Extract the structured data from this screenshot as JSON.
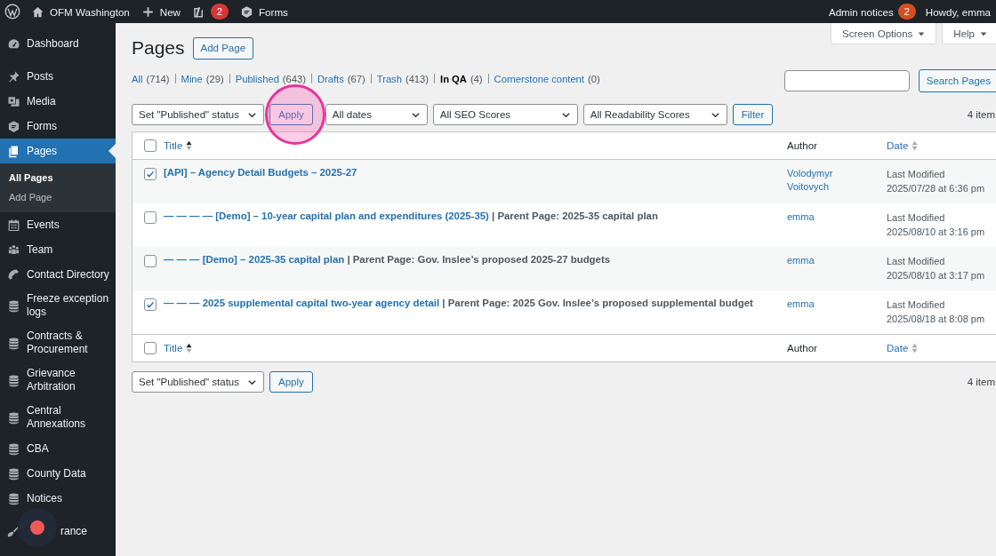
{
  "admin_bar": {
    "site_name": "OFM Washington",
    "new_label": "New",
    "seo_badge": "2",
    "forms_label": "Forms",
    "notices_label": "Admin notices",
    "notices_badge": "2",
    "greeting": "Howdy, emma"
  },
  "sidebar": {
    "groups": [
      {
        "items": [
          {
            "label": "Dashboard",
            "selected": false
          }
        ]
      },
      {
        "items": [
          {
            "label": "Posts",
            "selected": false
          },
          {
            "label": "Media",
            "selected": false
          },
          {
            "label": "Forms",
            "selected": false
          },
          {
            "label": "Pages",
            "selected": true,
            "children": [
              {
                "label": "All Pages",
                "selected": true
              },
              {
                "label": "Add Page",
                "selected": false
              }
            ]
          },
          {
            "label": "Events",
            "selected": false
          },
          {
            "label": "Team",
            "selected": false
          },
          {
            "label": "Contact Directory",
            "selected": false
          },
          {
            "label": "Freeze exception logs",
            "selected": false
          },
          {
            "label": "Contracts & Procurement",
            "selected": false
          },
          {
            "label": "Grievance Arbitration",
            "selected": false
          },
          {
            "label": "Central Annexations",
            "selected": false
          },
          {
            "label": "CBA",
            "selected": false
          },
          {
            "label": "County Data",
            "selected": false
          },
          {
            "label": "Notices",
            "selected": false
          }
        ]
      },
      {
        "items": [
          {
            "label": "rance",
            "selected": false,
            "covered": true
          }
        ]
      }
    ]
  },
  "screen_meta": [
    {
      "label": "Screen Options"
    },
    {
      "label": "Help"
    }
  ],
  "heading": {
    "title": "Pages",
    "button": "Add Page"
  },
  "views": [
    {
      "label": "All",
      "count": "(714)",
      "selected": false
    },
    {
      "label": "Mine",
      "count": "(29)",
      "selected": false
    },
    {
      "label": "Published",
      "count": "(643)",
      "selected": false
    },
    {
      "label": "Drafts",
      "count": "(67)",
      "selected": false
    },
    {
      "label": "Trash",
      "count": "(413)",
      "selected": false
    },
    {
      "label": "In QA",
      "count": "(4)",
      "selected": true
    },
    {
      "label": "Cornerstone content",
      "count": "(0)",
      "selected": false
    }
  ],
  "search": {
    "button": "Search Pages"
  },
  "bulk_top": {
    "action": "Set \"Published\" status",
    "apply": "Apply"
  },
  "filters": [
    {
      "value": "All dates"
    },
    {
      "value": "All SEO Scores"
    },
    {
      "value": "All Readability Scores"
    }
  ],
  "filter_button": "Filter",
  "items_count_top": "4 item",
  "table": {
    "header": {
      "checked": false,
      "columns": [
        {
          "label": "Title",
          "kind": "sortable",
          "sorted": true
        },
        {
          "label": "Author",
          "kind": "plain"
        },
        {
          "label": "Date",
          "kind": "sortable",
          "sorted": false
        }
      ]
    },
    "rows": [
      {
        "checked": true,
        "title": "[API] – Agency Detail Budgets – 2025-27",
        "author": [
          "Volodymyr",
          "Voitovych"
        ],
        "date_status": "Last Modified",
        "date": "2025/07/28 at 6:36 pm"
      },
      {
        "checked": false,
        "title": "— — — — [Demo] – 10-year capital plan and expenditures (2025-35)",
        "parent": "| Parent Page: 2025-35 capital plan",
        "author": [
          "emma"
        ],
        "date_status": "Last Modified",
        "date": "2025/08/10 at 3:16 pm"
      },
      {
        "checked": false,
        "title": "— — — [Demo] – 2025-35 capital plan",
        "parent": "| Parent Page: Gov. Inslee’s proposed 2025-27 budgets",
        "author": [
          "emma"
        ],
        "date_status": "Last Modified",
        "date": "2025/08/10 at 3:17 pm"
      },
      {
        "checked": true,
        "title": "— — — 2025 supplemental capital two-year agency detail",
        "parent": "| Parent Page: 2025 Gov. Inslee’s proposed supplemental budget",
        "author": [
          "emma"
        ],
        "date_status": "Last Modified",
        "date": "2025/08/18 at 8:08 pm"
      }
    ],
    "footer": {
      "checked": false,
      "columns": [
        {
          "label": "Title",
          "kind": "sortable",
          "sorted": true
        },
        {
          "label": "Author",
          "kind": "plain"
        },
        {
          "label": "Date",
          "kind": "sortable",
          "sorted": false
        }
      ]
    }
  },
  "bulk_bottom": {
    "action": "Set \"Published\" status",
    "apply": "Apply"
  },
  "items_count_bottom": "4 item"
}
